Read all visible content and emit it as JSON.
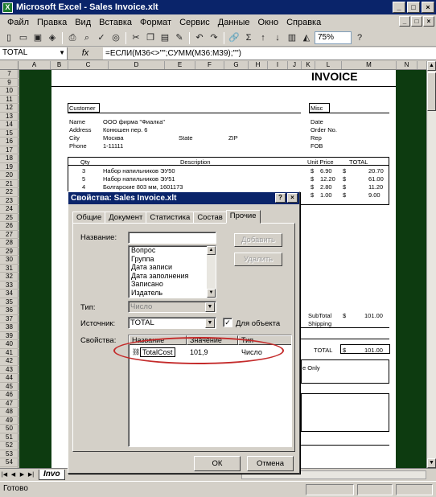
{
  "window": {
    "title": "Microsoft Excel - Sales Invoice.xlt"
  },
  "menu": [
    "Файл",
    "Правка",
    "Вид",
    "Вставка",
    "Формат",
    "Сервис",
    "Данные",
    "Окно",
    "Справка"
  ],
  "toolbar": {
    "zoom": "75%",
    "sigma": "Σ"
  },
  "formula_bar": {
    "name_box": "TOTAL",
    "fx": "fx",
    "formula": "=ЕСЛИ(M36<>\"\";СУММ(M36:M39);\"\")"
  },
  "columns": [
    "A",
    "B",
    "C",
    "D",
    "E",
    "F",
    "G",
    "H",
    "I",
    "J",
    "K",
    "L",
    "M",
    "N"
  ],
  "rows": [
    "7",
    "9",
    "10",
    "11",
    "12",
    "13",
    "14",
    "15",
    "16",
    "17",
    "18",
    "19",
    "20",
    "21",
    "22",
    "23",
    "24",
    "25",
    "26",
    "27",
    "28",
    "29",
    "30",
    "31",
    "32",
    "33",
    "34",
    "35",
    "36",
    "37",
    "38",
    "39",
    "40",
    "41",
    "42",
    "43",
    "44",
    "45",
    "46",
    "47",
    "48",
    "49",
    "50",
    "51",
    "52",
    "53",
    "54"
  ],
  "invoice": {
    "heading": "INVOICE",
    "customer_label": "Customer",
    "misc_label": "Misc",
    "fields": [
      {
        "label": "Name",
        "value": "ООО фирма \"Фиалка\""
      },
      {
        "label": "Address",
        "value": "Конюшен пер. 6"
      },
      {
        "label": "City",
        "value": "Москва",
        "state_label": "State",
        "zip_label": "ZIP"
      },
      {
        "label": "Phone",
        "value": "1-11111"
      }
    ],
    "misc_fields": [
      "Date",
      "Order No.",
      "Rep",
      "FOB"
    ],
    "table_headers": {
      "qty": "Qty",
      "description": "Description",
      "unit_price": "Unit Price",
      "total": "TOTAL"
    },
    "lines": [
      {
        "qty": "3",
        "description": "Набор напильников ЭУ50",
        "cur1": "$",
        "price": "6.90",
        "cur2": "$",
        "total": "20.70"
      },
      {
        "qty": "5",
        "description": "Набор напильников ЭУ51",
        "cur1": "$",
        "price": "12.20",
        "cur2": "$",
        "total": "61.00"
      },
      {
        "qty": "4",
        "description": "Болгарские 803 мм, 1601173",
        "cur1": "$",
        "price": "2.80",
        "cur2": "$",
        "total": "11.20"
      },
      {
        "qty": "",
        "description": "",
        "cur1": "$",
        "price": "1.00",
        "cur2": "$",
        "total": "9.00"
      }
    ],
    "subtotal_label": "SubTotal",
    "subtotal_cur": "$",
    "subtotal_value": "101.00",
    "shipping_label": "Shipping",
    "total_label": "TOTAL",
    "total_cur": "$",
    "total_value": "101.00",
    "note_fragment": "e Only"
  },
  "sheet_tab": "Invo",
  "status": "Готово",
  "dialog": {
    "title": "Свойства: Sales Invoice.xlt",
    "tabs": [
      "Общие",
      "Документ",
      "Статистика",
      "Состав",
      "Прочие"
    ],
    "active_tab": "Прочие",
    "name_label": "Название:",
    "name_value": "",
    "name_options": [
      "Вопрос",
      "Группа",
      "Дата записи",
      "Дата заполнения",
      "Записано",
      "Издатель"
    ],
    "add_button": "Добавить",
    "delete_button": "Удалить",
    "type_label": "Тип:",
    "type_value": "Число",
    "source_label": "Источник:",
    "source_value": "TOTAL",
    "link_checkbox_label": "Для объекта",
    "link_checked": "✓",
    "properties_label": "Свойства:",
    "grid_headers": [
      "Название",
      "Значение",
      "Тип"
    ],
    "properties": [
      {
        "name": "TotalCost",
        "value": "101,9",
        "type": "Число"
      }
    ],
    "ok_button": "ОК",
    "cancel_button": "Отмена"
  },
  "colors": {
    "title_bar": "#0a246a",
    "sheet_border": "#0d3b10",
    "highlight_ellipse": "#c42b2b"
  }
}
